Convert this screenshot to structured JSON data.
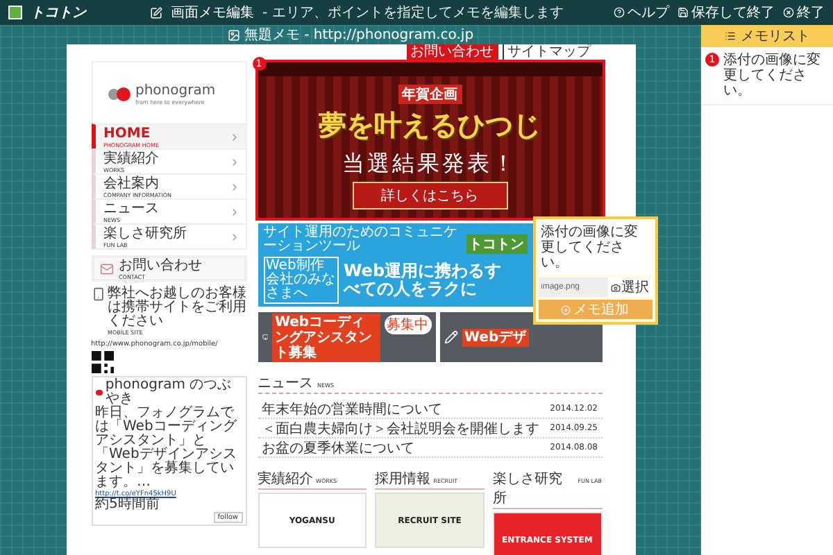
{
  "app_bar": {
    "logo": "トコトン",
    "title": "画面メモ編集",
    "subtitle": "- エリア、ポイントを指定してメモを編集します",
    "actions": [
      {
        "kind": "help",
        "label": "ヘルプ"
      },
      {
        "kind": "save",
        "label": "保存して終了"
      },
      {
        "kind": "exit",
        "label": "終了"
      }
    ]
  },
  "canvas": {
    "caption": "無題メモ - http://phonogram.co.jp"
  },
  "site": {
    "header_links": [
      {
        "label": "お問い合わせ",
        "kind": "primary"
      },
      {
        "label": "サイトマップ",
        "kind": "plain"
      }
    ],
    "logo": {
      "name": "phonogram",
      "tagline": "from here to everywhere"
    },
    "nav": [
      {
        "label": "HOME",
        "sub": "PHONOGRAM HOME",
        "selected": true
      },
      {
        "label": "実績紹介",
        "sub": "WORKS",
        "selected": false
      },
      {
        "label": "会社案内",
        "sub": "COMPANY INFORMATION",
        "selected": false
      },
      {
        "label": "ニュース",
        "sub": "NEWS",
        "selected": false
      },
      {
        "label": "楽しさ研究所",
        "sub": "FUN LAB",
        "selected": false
      }
    ],
    "contact": {
      "label": "お問い合わせ",
      "sub": "CONTACT"
    },
    "mobile": {
      "text": "弊社へお越しのお客様は携帯サイトをご利用ください",
      "sub": "MOBILE SITE",
      "url": "http://www.phonogram.co.jp/mobile/"
    },
    "twitter": {
      "account": "phonogram のつぶやき",
      "text": "昨日、フォノグラムでは「Webコーディングアシスタント」と「Webデザインアシスタント」を募集しています。…",
      "link": "http://t.co/eYFn4SkH9U",
      "time": "約5時間前",
      "follow": "follow"
    },
    "banner": {
      "tag": "年賀企画",
      "title": "夢を叶えるひつじ",
      "headline": "当選結果発表！",
      "button": "詳しくはこちら",
      "memo_number": "1"
    },
    "web_banner": {
      "caption": "サイト運用のためのコミュニケーションツール",
      "brand": "トコトン",
      "side": "Web制作会社のみなさまへ",
      "headline": "Web運用に携わるすべての人をラクに"
    },
    "recruit_banners": [
      {
        "title": "Webコーディングアシスタント募集",
        "badge": "募集中"
      },
      {
        "title": "Webデザ"
      }
    ],
    "news": {
      "title": "ニュース",
      "sub": "NEWS",
      "items": [
        {
          "title": "年末年始の営業時間について",
          "date": "2014.12.02"
        },
        {
          "title": "＜面白農夫婦向け＞会社説明会を開催します",
          "date": "2014.09.25"
        },
        {
          "title": "お盆の夏季休業について",
          "date": "2014.08.08"
        }
      ]
    },
    "sections": [
      {
        "title": "実績紹介",
        "sub": "WORKS",
        "image_text": "YOGANSU"
      },
      {
        "title": "採用情報",
        "sub": "RECRUIT",
        "image_text": "RECRUIT SITE"
      },
      {
        "title": "楽しさ研究所",
        "sub": "FUN LAB",
        "image_text": "ENTRANCE SYSTEM"
      }
    ]
  },
  "memo_popup": {
    "text": "添付の画像に変更してください。",
    "file": "image.png",
    "choose": "選択",
    "submit": "メモ追加"
  },
  "memo_list": {
    "title": "メモリスト",
    "items": [
      {
        "number": "1",
        "text": "添付の画像に変更してください。",
        "selected": false
      }
    ]
  }
}
